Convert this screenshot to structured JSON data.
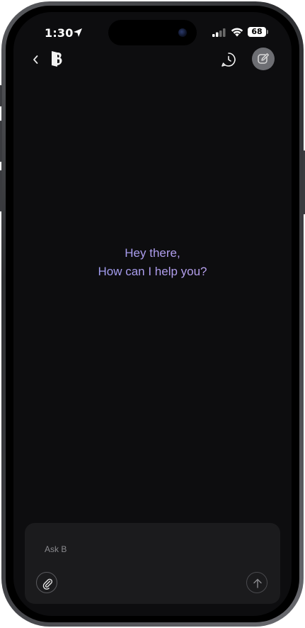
{
  "status_bar": {
    "time": "1:30",
    "battery_level": "68",
    "icons": [
      "location-arrow-icon",
      "cellular-signal-icon",
      "wifi-icon",
      "battery-icon"
    ]
  },
  "header": {
    "icons": [
      "chevron-left-icon",
      "app-logo-icon",
      "history-icon",
      "new-chat-icon"
    ]
  },
  "greeting": {
    "line1": "Hey there,",
    "line2": "How can I help you?"
  },
  "composer": {
    "placeholder": "Ask B",
    "value": "",
    "icons": [
      "paperclip-icon",
      "arrow-up-icon"
    ]
  },
  "colors": {
    "background": "#0d0d0f",
    "greeting_gradient_start": "#8c9cf7",
    "greeting_gradient_end": "#c7a6ef",
    "composer_background": "#1b1b1d"
  }
}
